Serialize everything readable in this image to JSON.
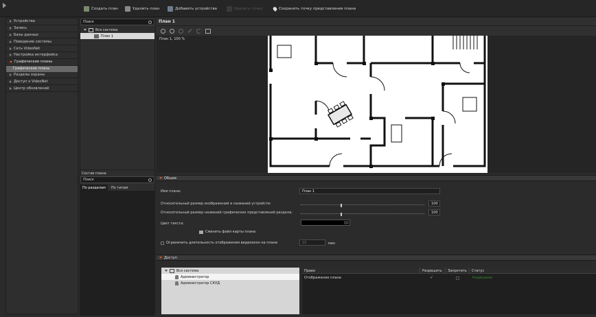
{
  "toolbar": {
    "create_plan": "Создать план",
    "delete_plan": "Удалить план",
    "add_devices": "Добавить устройства",
    "disabled_action": "Удалить точку",
    "save_view_point": "Сохранить точку представления плана"
  },
  "nav": {
    "items": [
      {
        "label": "Устройства"
      },
      {
        "label": "Запись"
      },
      {
        "label": "Базы данных"
      },
      {
        "label": "Поведение системы"
      },
      {
        "label": "Сеть VideoNet"
      },
      {
        "label": "Настройка интерфейса"
      },
      {
        "label": "Графические планы"
      },
      {
        "label": "Разделы охраны"
      },
      {
        "label": "Доступ к VideoNet"
      },
      {
        "label": "Центр обновлений"
      }
    ],
    "sub_item": "Графические планы"
  },
  "tree": {
    "search_placeholder": "Поиск",
    "root": "Вся система",
    "child": "План 1"
  },
  "composition": {
    "title": "Состав плана",
    "search_placeholder": "Поиск",
    "tab_sections": "По разделам",
    "tab_types": "По типам"
  },
  "plan": {
    "title": "План 1",
    "zoom_text": "План 1, 100 %"
  },
  "general": {
    "section": "Общие",
    "name_label": "Имя плана:",
    "name_value": "План 1",
    "device_size_label": "Относительный размер изображений и названий устройств:",
    "device_size_value": "100",
    "section_size_label": "Относительный размер названий графических представлений раздела:",
    "section_size_value": "100",
    "text_color_label": "Цвет текста:",
    "change_map_label": "Сменить файл карты плана",
    "limit_label": "Ограничить длительность отображения видеоокон на плане",
    "limit_value": "15",
    "limit_unit": "мин"
  },
  "access": {
    "section": "Доступ",
    "tree_root": "Вся система",
    "users": [
      "Администратор",
      "Администратор СКУД"
    ],
    "columns": {
      "right": "Право",
      "allow": "Разрешить",
      "deny": "Запретить",
      "status": "Статус"
    },
    "row_right": "Отображение плана",
    "row_status": "Разрешено"
  },
  "colors": {
    "accent": "#e05a1a",
    "status_green": "#2e8b2e"
  }
}
